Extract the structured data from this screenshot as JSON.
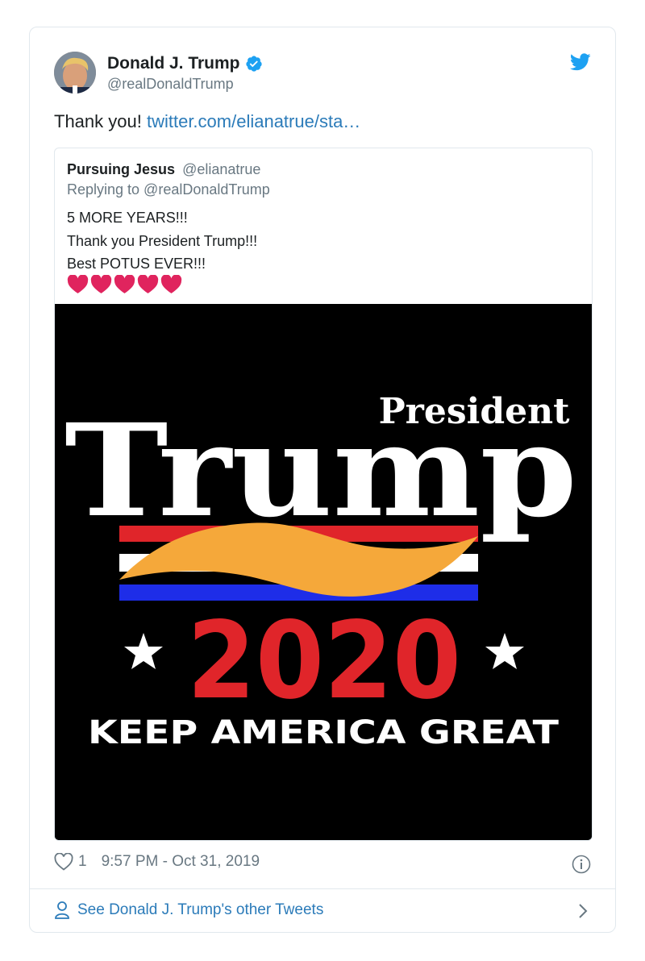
{
  "tweet": {
    "author_name": "Donald J. Trump",
    "author_handle": "@realDonaldTrump",
    "text": "Thank you!",
    "link": "twitter.com/elianatrue/sta…",
    "verified": true
  },
  "quote": {
    "author_name": "Pursuing Jesus",
    "author_handle": "@elianatrue",
    "reply_context": "Replying to @realDonaldTrump",
    "lines": [
      "5 MORE YEARS!!!",
      "Thank you President Trump!!!",
      "Best POTUS EVER!!!"
    ],
    "emoji_hearts": 5,
    "image": {
      "title_small": "President",
      "title_big": "Trump",
      "year": "2020",
      "slogan": "KEEP AMERICA GREAT"
    }
  },
  "footer": {
    "like_count": "1",
    "timestamp": "9:57 PM - Oct 31, 2019",
    "see_more": "See Donald J. Trump's other Tweets"
  },
  "icons": [
    "avatar",
    "verified-badge-icon",
    "twitter-bird-icon",
    "heart-emoji",
    "like-heart-icon",
    "info-icon",
    "person-icon",
    "chevron-right-icon"
  ],
  "colors": {
    "link": "#2b7bb9",
    "secondary_text": "#697882",
    "border": "#e1e8ed",
    "heart_red": "#e0245e",
    "flag_red": "#e0252a",
    "flag_blue": "#1e2de8",
    "swoosh": "#f5a83a"
  }
}
